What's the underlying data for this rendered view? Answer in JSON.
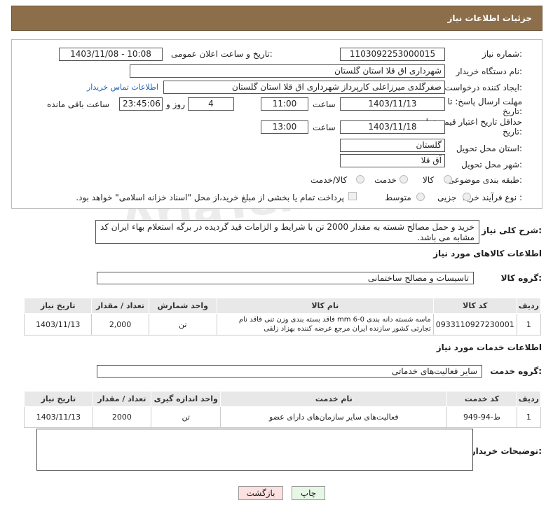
{
  "header": {
    "title": "جزئیات اطلاعات نیاز"
  },
  "form": {
    "need_number_label": "شماره نیاز:",
    "need_number": "1103092253000015",
    "announce_label": "تاریخ و ساعت اعلان عمومی:",
    "announce_value": "1403/11/08 - 10:08",
    "buyer_org_label": "نام دستگاه خریدار:",
    "buyer_org": "شهرداری اق قلا استان گلستان",
    "requester_label": "ایجاد کننده درخواست:",
    "requester": "صفرگلدی میرزاعلی کارپرداز شهرداری اق قلا استان گلستان",
    "contact_link": "اطلاعات تماس خریدار",
    "deadline_label_1": "مهلت ارسال پاسخ: تا",
    "deadline_label_2": "تاریخ:",
    "deadline_date": "1403/11/13",
    "time_label": "ساعت",
    "deadline_time": "11:00",
    "days_value": "4",
    "days_label": "روز و",
    "remaining_time": "23:45:06",
    "remaining_label": "ساعت باقی مانده",
    "validity_label_1": "حداقل تاریخ اعتبار قیمت: تا",
    "validity_label_2": "تاریخ:",
    "validity_date": "1403/11/18",
    "validity_time": "13:00",
    "province_label": "استان محل تحویل:",
    "province": "گلستان",
    "city_label": "شهر محل تحویل:",
    "city": "آق قلا",
    "category_label": "طبقه بندی موضوعی:",
    "category_options": [
      "کالا",
      "خدمت",
      "کالا/خدمت"
    ],
    "process_label": "نوع فرآیند خرید :",
    "process_options": [
      "جزیی",
      "متوسط"
    ],
    "payment_note": "پرداخت تمام یا بخشی از مبلغ خرید،از محل \"اسناد خزانه اسلامی\" خواهد بود."
  },
  "description": {
    "label": "شرح کلی نیاز:",
    "text": "خرید و حمل مصالح شسته به مقدار 2000 تن با شرایط و الزامات قید گردیده در برگه استعلام بهاء ایران کد مشابه می باشد."
  },
  "goods": {
    "section_title": "اطلاعات کالاهای مورد نیاز",
    "group_label": "گروه کالا:",
    "group_value": "تاسیسات و مصالح ساختمانی",
    "headers": [
      "ردیف",
      "کد کالا",
      "نام کالا",
      "واحد شمارش",
      "تعداد / مقدار",
      "تاریخ نیاز"
    ],
    "rows": [
      {
        "row": "1",
        "code": "0933110927230001",
        "name": "ماسه شسته دانه بندی mm 6-0 فاقد بسته بندی وزن تنی فاقد نام تجارتی کشور سازنده ایران مرجع عرضه کننده بهزاد زلقی",
        "unit": "تن",
        "qty": "2,000",
        "date": "1403/11/13"
      }
    ]
  },
  "services": {
    "section_title": "اطلاعات خدمات مورد نیاز",
    "group_label": "گروه خدمت:",
    "group_value": "سایر فعالیت‌های خدماتی",
    "headers": [
      "ردیف",
      "کد خدمت",
      "نام خدمت",
      "واحد اندازه گیری",
      "تعداد / مقدار",
      "تاریخ نیاز"
    ],
    "rows": [
      {
        "row": "1",
        "code": "ط-94-949",
        "name": "فعالیت‌های سایر سازمان‌های دارای عضو",
        "unit": "تن",
        "qty": "2000",
        "date": "1403/11/13"
      }
    ]
  },
  "buyer_notes": {
    "label": "توضیحات خریدار:",
    "value": ""
  },
  "buttons": {
    "print": "چاپ",
    "back": "بازگشت"
  },
  "watermark": "AriaTender.net",
  "colors": {
    "header": "#8d6e4a",
    "link": "#1a5fb4",
    "back_button": "#fde0e0",
    "print_button": "#e6f7e6"
  }
}
